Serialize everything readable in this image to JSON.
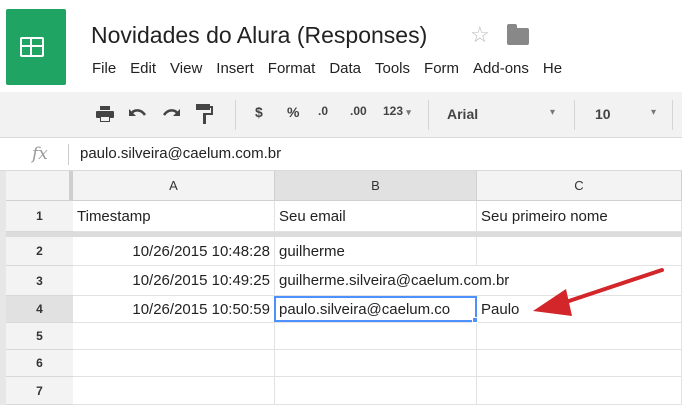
{
  "app": {
    "doc_title": "Novidades do Alura (Responses)",
    "icons": {
      "logo": "google-sheets-logo-icon",
      "star": "star-icon",
      "folder": "folder-icon"
    },
    "brand_color": "#1fa463"
  },
  "menu": [
    "File",
    "Edit",
    "View",
    "Insert",
    "Format",
    "Data",
    "Tools",
    "Form",
    "Add-ons",
    "He"
  ],
  "toolbar": {
    "currency": "$",
    "percent": "%",
    "decrease_decimals": ".0",
    "increase_decimals": ".00",
    "more_formats": "123",
    "font": "Arial",
    "font_size": "10"
  },
  "formula_bar": {
    "fx": "fx",
    "value": "paulo.silveira@caelum.com.br"
  },
  "grid": {
    "columns": [
      "A",
      "B",
      "C"
    ],
    "rows": [
      {
        "num": "1",
        "a": "Timestamp",
        "b": "Seu email",
        "c": "Seu primeiro nome"
      },
      {
        "num": "2",
        "a": "10/26/2015 10:48:28",
        "b": "guilherme",
        "c": ""
      },
      {
        "num": "3",
        "a": "10/26/2015 10:49:25",
        "b": "guilherme.silveira@caelum.com.br",
        "c": ""
      },
      {
        "num": "4",
        "a": "10/26/2015 10:50:59",
        "b": "paulo.silveira@caelum.co",
        "c": "Paulo"
      },
      {
        "num": "5",
        "a": "",
        "b": "",
        "c": ""
      },
      {
        "num": "6",
        "a": "",
        "b": "",
        "c": ""
      },
      {
        "num": "7",
        "a": "",
        "b": "",
        "c": ""
      }
    ],
    "selected_cell": "B4",
    "selection_color": "#4d90fe",
    "annotation_arrow_color": "#d3262b"
  }
}
